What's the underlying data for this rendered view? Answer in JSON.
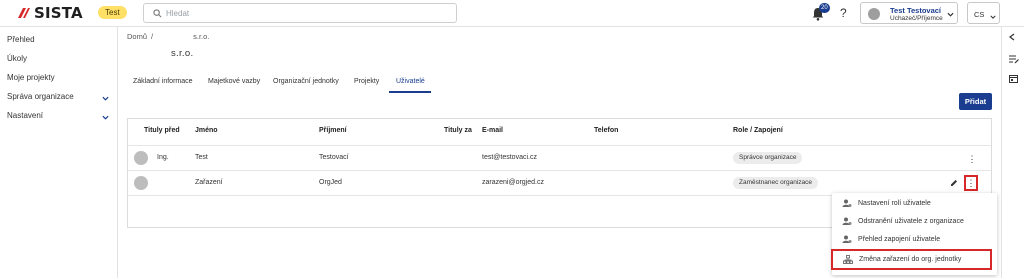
{
  "header": {
    "logo_text": "SISTA",
    "env_badge": "Test",
    "search": {
      "placeholder": "Hledat",
      "value": ""
    },
    "notifications": {
      "count": "20"
    },
    "help_label": "?",
    "user": {
      "name": "Test Testovací",
      "role": "Uchazeč/Příjemce"
    },
    "language": "CS"
  },
  "sidebar": {
    "items": [
      {
        "label": "Přehled"
      },
      {
        "label": "Úkoly"
      },
      {
        "label": "Moje projekty"
      },
      {
        "label": "Správa organizace"
      },
      {
        "label": "Nastavení"
      }
    ]
  },
  "breadcrumb": {
    "home": "Domů",
    "separator": "/",
    "current": "s.r.o."
  },
  "page": {
    "title": "s.r.o."
  },
  "tabs": [
    {
      "label": "Základní informace"
    },
    {
      "label": "Majetkové vazby"
    },
    {
      "label": "Organizační jednotky"
    },
    {
      "label": "Projekty"
    },
    {
      "label": "Uživatelé"
    }
  ],
  "add_button": "Přidat",
  "table": {
    "columns": [
      "Tituly před",
      "Jméno",
      "Příjmení",
      "Tituly za",
      "E-mail",
      "Telefon",
      "Role / Zapojení"
    ],
    "rows": [
      {
        "titles_before": "Ing.",
        "first_name": "Test",
        "last_name": "Testovací",
        "titles_after": "",
        "email": "test@testovaci.cz",
        "phone": "",
        "role": "Správce organizace"
      },
      {
        "titles_before": "",
        "first_name": "Zařazení",
        "last_name": "OrgJed",
        "titles_after": "",
        "email": "zarazeni@orgjed.cz",
        "phone": "",
        "role": "Zaměstnanec organizace"
      }
    ],
    "more_glyph": "⋮"
  },
  "context_menu": {
    "items": [
      {
        "label": "Nastavení rolí uživatele"
      },
      {
        "label": "Odstranění uživatele z organizace"
      },
      {
        "label": "Přehled zapojení uživatele"
      },
      {
        "label": "Změna zařazení do org. jednotky"
      }
    ]
  },
  "colors": {
    "primary": "#1a3d8f",
    "badge": "#ffe066",
    "highlight": "#d62828",
    "logo_red": "#d62828"
  }
}
